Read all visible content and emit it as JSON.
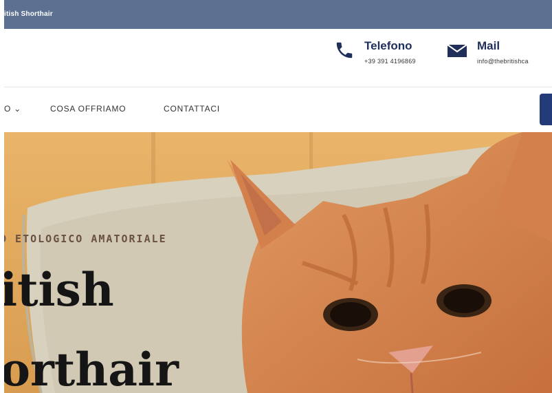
{
  "topbar": {
    "brand": "itish Shorthair"
  },
  "contacts": [
    {
      "title": "Telefono",
      "value": "+39 391 4196869",
      "icon": "phone-icon"
    },
    {
      "title": "Mail",
      "value": "info@thebritishca",
      "icon": "mail-icon"
    }
  ],
  "nav": {
    "truncated_item": "O",
    "items": [
      "COSA OFFRIAMO",
      "CONTATTACI"
    ]
  },
  "hero": {
    "eyebrow": "O ETOLOGICO AMATORIALE",
    "title_line1": "itish",
    "title_line2": "orthair"
  },
  "colors": {
    "topbar": "#5c7191",
    "navy": "#1f2f5a",
    "cta": "#243b7a"
  }
}
